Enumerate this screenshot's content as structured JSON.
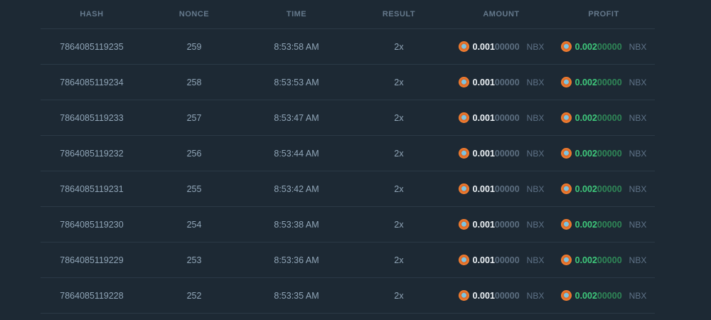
{
  "header": {
    "columns": [
      {
        "label": "HASH"
      },
      {
        "label": "NONCE"
      },
      {
        "label": "TIME"
      },
      {
        "label": "RESULT"
      },
      {
        "label": "AMOUNT"
      },
      {
        "label": "PROFIT"
      }
    ]
  },
  "currency": "NBX",
  "rows": [
    {
      "hash": "7864085119235",
      "nonce": "259",
      "time": "8:53:58 AM",
      "result": "2x",
      "amount": {
        "main": "0.001",
        "zeros": "00000"
      },
      "profit": {
        "main": "0.002",
        "zeros": "00000"
      }
    },
    {
      "hash": "7864085119234",
      "nonce": "258",
      "time": "8:53:53 AM",
      "result": "2x",
      "amount": {
        "main": "0.001",
        "zeros": "00000"
      },
      "profit": {
        "main": "0.002",
        "zeros": "00000"
      }
    },
    {
      "hash": "7864085119233",
      "nonce": "257",
      "time": "8:53:47 AM",
      "result": "2x",
      "amount": {
        "main": "0.001",
        "zeros": "00000"
      },
      "profit": {
        "main": "0.002",
        "zeros": "00000"
      }
    },
    {
      "hash": "7864085119232",
      "nonce": "256",
      "time": "8:53:44 AM",
      "result": "2x",
      "amount": {
        "main": "0.001",
        "zeros": "00000"
      },
      "profit": {
        "main": "0.002",
        "zeros": "00000"
      }
    },
    {
      "hash": "7864085119231",
      "nonce": "255",
      "time": "8:53:42 AM",
      "result": "2x",
      "amount": {
        "main": "0.001",
        "zeros": "00000"
      },
      "profit": {
        "main": "0.002",
        "zeros": "00000"
      }
    },
    {
      "hash": "7864085119230",
      "nonce": "254",
      "time": "8:53:38 AM",
      "result": "2x",
      "amount": {
        "main": "0.001",
        "zeros": "00000"
      },
      "profit": {
        "main": "0.002",
        "zeros": "00000"
      }
    },
    {
      "hash": "7864085119229",
      "nonce": "253",
      "time": "8:53:36 AM",
      "result": "2x",
      "amount": {
        "main": "0.001",
        "zeros": "00000"
      },
      "profit": {
        "main": "0.002",
        "zeros": "00000"
      }
    },
    {
      "hash": "7864085119228",
      "nonce": "252",
      "time": "8:53:35 AM",
      "result": "2x",
      "amount": {
        "main": "0.001",
        "zeros": "00000"
      },
      "profit": {
        "main": "0.002",
        "zeros": "00000"
      }
    }
  ],
  "icons": {
    "coin": "nbx-coin-icon"
  },
  "colors": {
    "background": "#1d2934",
    "separator": "#2b3946",
    "header_text": "#65798c",
    "row_text": "#90a5b7",
    "amount_main": "#eef3f7",
    "amount_zeros": "#5d6f81",
    "profit_main": "#3fca7c",
    "profit_zeros": "#2f8757",
    "currency_text": "#5f7388",
    "coin_orange": "#f07c2f",
    "coin_center": "#7fc3e0"
  }
}
